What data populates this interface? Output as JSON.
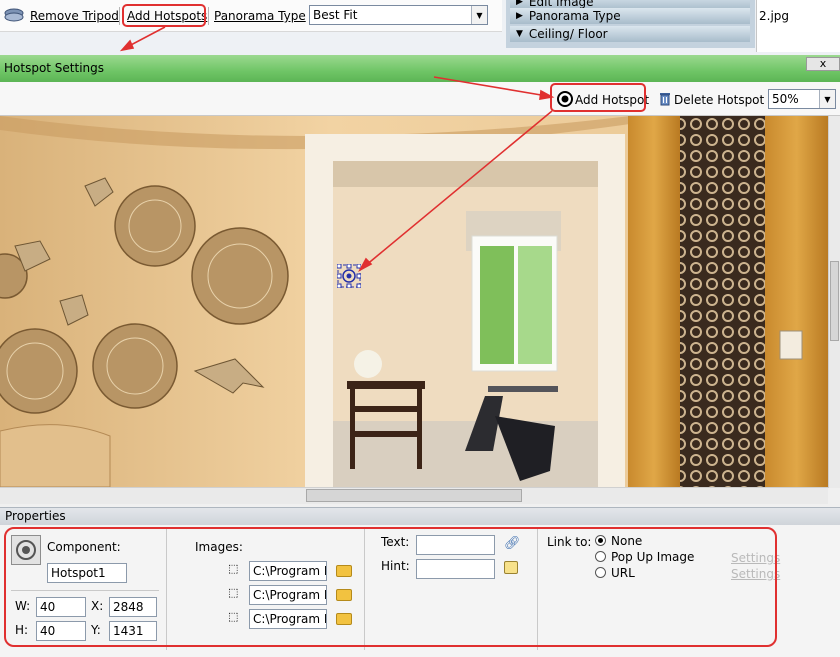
{
  "top_toolbar": {
    "remove_tripod": "Remove Tripod",
    "add_hotspots": "Add Hotspots",
    "panorama_type_label": "Panorama Type",
    "panorama_type_value": "Best Fit"
  },
  "right_panel": {
    "items": [
      "Edit Image",
      "Panorama Type",
      "Ceiling/ Floor"
    ],
    "thumb_label": "2.jpg"
  },
  "dialog": {
    "title": "Hotspot Settings",
    "close": "x",
    "add_hotspot": "Add Hotspot",
    "delete_hotspot": "Delete Hotspot",
    "zoom": "50%"
  },
  "properties": {
    "header": "Properties",
    "component_label": "Component:",
    "component_value": "Hotspot1",
    "w_label": "W:",
    "w_value": "40",
    "h_label": "H:",
    "h_value": "40",
    "x_label": "X:",
    "x_value": "2848",
    "y_label": "Y:",
    "y_value": "1431",
    "images_label": "Images:",
    "image_paths": [
      "C:\\Program Fil",
      "C:\\Program Fil",
      "C:\\Program Fil"
    ],
    "text_label": "Text:",
    "hint_label": "Hint:",
    "link_to_label": "Link to:",
    "link_options": [
      "None",
      "Pop Up Image",
      "URL"
    ],
    "link_selected": "None",
    "settings_labels": [
      "Settings",
      "Settings"
    ]
  },
  "colors": {
    "titlebar": "#6fc566",
    "annotation_red": "#e03030",
    "hotspot_blue": "#2430a8"
  }
}
